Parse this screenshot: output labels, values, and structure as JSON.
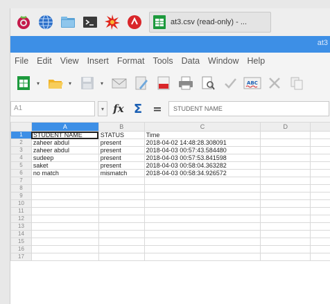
{
  "taskbar": {
    "icons": [
      "raspberry-icon",
      "globe-icon",
      "folder-icon",
      "terminal-icon",
      "burst-icon",
      "record-icon"
    ],
    "window_button_label": "at3.csv (read-only) - ..."
  },
  "titlebar": {
    "title_fragment": "at3"
  },
  "menubar": {
    "items": [
      "File",
      "Edit",
      "View",
      "Insert",
      "Format",
      "Tools",
      "Data",
      "Window",
      "Help"
    ]
  },
  "formula_bar": {
    "name_box": "A1",
    "value": "STUDENT NAME"
  },
  "sheet": {
    "columns": [
      "A",
      "B",
      "C",
      "D"
    ],
    "selected_column": "A",
    "rows": [
      [
        "STUDENT NAME",
        "STATUS",
        "Time",
        ""
      ],
      [
        "zaheer abdul",
        "present",
        "2018-04-02 14:48:28.308091",
        ""
      ],
      [
        "zaheer abdul",
        "present",
        "2018-04-03 00:57:43.584480",
        ""
      ],
      [
        "sudeep",
        "present",
        "2018-04-03 00:57:53.841598",
        ""
      ],
      [
        "saket",
        "present",
        "2018-04-03 00:58:04.363282",
        ""
      ],
      [
        "no match",
        "mismatch",
        "2018-04-03 00:58:34.926572",
        ""
      ]
    ],
    "row_numbers": [
      "1",
      "2",
      "3",
      "4",
      "5",
      "6",
      "7",
      "8",
      "9",
      "10",
      "11",
      "12",
      "13",
      "14",
      "15",
      "16",
      "17"
    ]
  },
  "colors": {
    "accent": "#3d8fe6",
    "grid_line": "#d9d9d9"
  }
}
